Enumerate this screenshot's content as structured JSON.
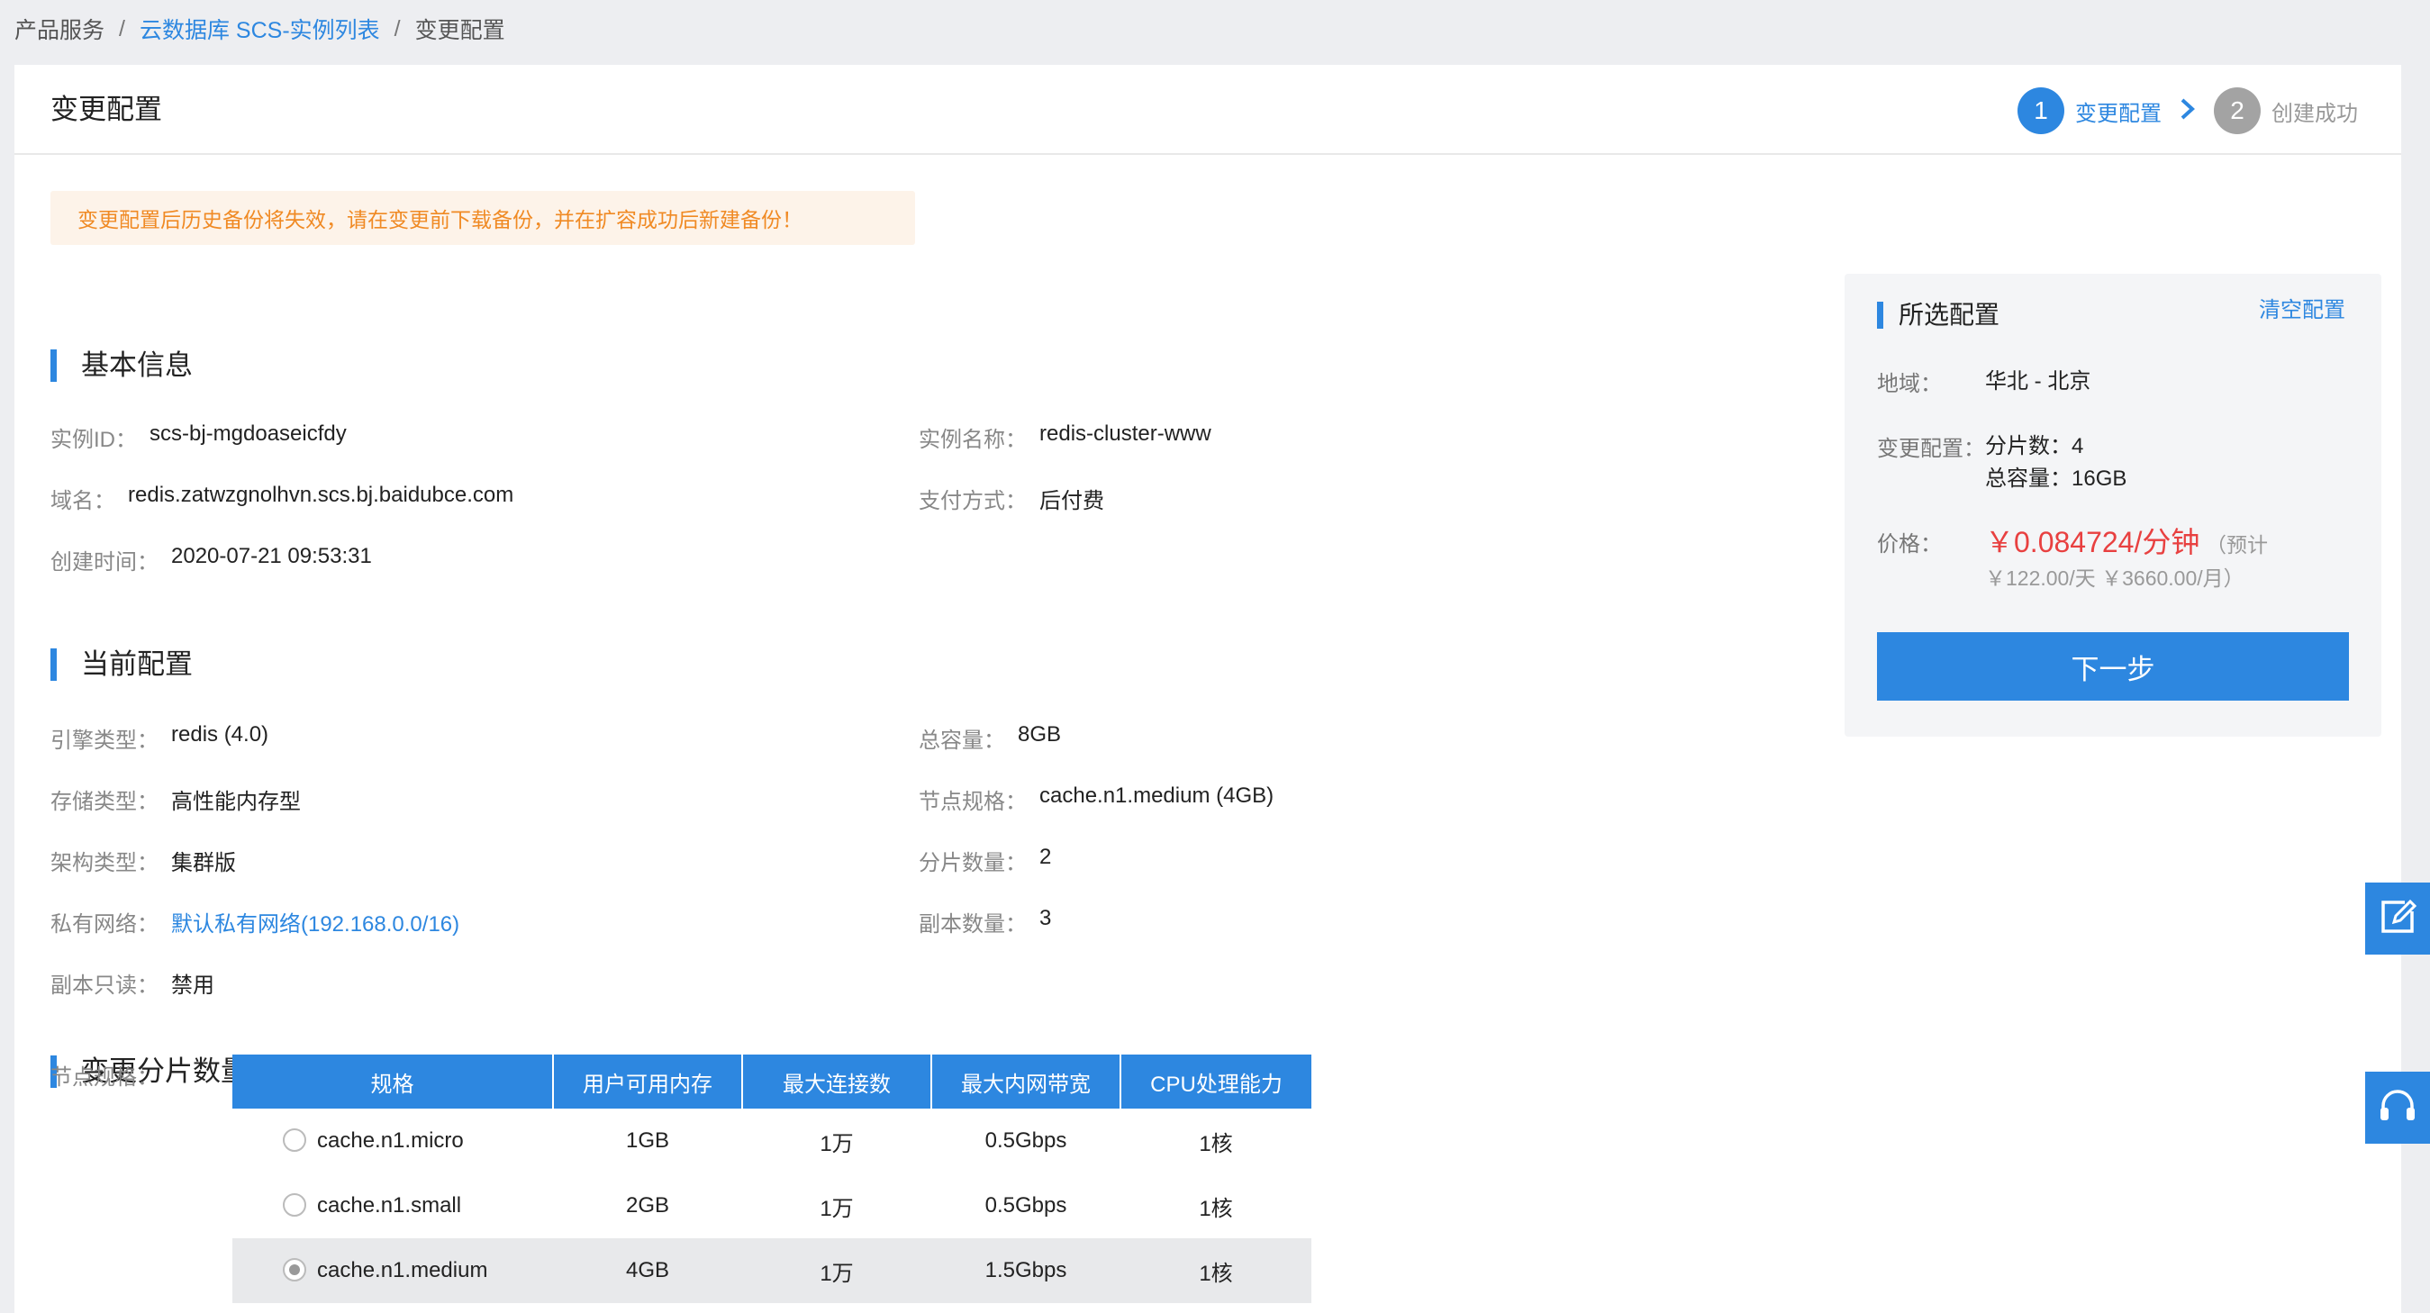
{
  "breadcrumb": {
    "item1": "产品服务",
    "item2": "云数据库 SCS-实例列表",
    "item3": "变更配置",
    "sep": "/"
  },
  "page_title": "变更配置",
  "steps": [
    {
      "num": "1",
      "label": "变更配置"
    },
    {
      "num": "2",
      "label": "创建成功"
    }
  ],
  "warning": "变更配置后历史备份将失效，请在变更前下载备份，并在扩容成功后新建备份！",
  "basic": {
    "title": "基本信息",
    "instance_id_label": "实例ID：",
    "instance_id": "scs-bj-mgdoaseicfdy",
    "instance_name_label": "实例名称：",
    "instance_name": "redis-cluster-www",
    "domain_label": "域名：",
    "domain": "redis.zatwzgnolhvn.scs.bj.baidubce.com",
    "pay_label": "支付方式：",
    "pay": "后付费",
    "created_label": "创建时间：",
    "created": "2020-07-21 09:53:31"
  },
  "current": {
    "title": "当前配置",
    "engine_label": "引擎类型：",
    "engine": "redis (4.0)",
    "capacity_label": "总容量：",
    "capacity": "8GB",
    "storage_label": "存储类型：",
    "storage": "高性能内存型",
    "node_spec_label": "节点规格：",
    "node_spec": "cache.n1.medium (4GB)",
    "arch_label": "架构类型：",
    "arch": "集群版",
    "shards_label": "分片数量：",
    "shards": "2",
    "vpc_label": "私有网络：",
    "vpc": "默认私有网络(192.168.0.0/16)",
    "replicas_label": "副本数量：",
    "replicas": "3",
    "readonly_label": "副本只读：",
    "readonly": "禁用"
  },
  "shard_change": {
    "title": "变更分片数量",
    "spec_label": "节点规格：",
    "columns": [
      "规格",
      "用户可用内存",
      "最大连接数",
      "最大内网带宽",
      "CPU处理能力"
    ],
    "rows": [
      {
        "name": "cache.n1.micro",
        "memory": "1GB",
        "conn": "1万",
        "bw": "0.5Gbps",
        "cpu": "1核",
        "selected": false
      },
      {
        "name": "cache.n1.small",
        "memory": "2GB",
        "conn": "1万",
        "bw": "0.5Gbps",
        "cpu": "1核",
        "selected": false
      },
      {
        "name": "cache.n1.medium",
        "memory": "4GB",
        "conn": "1万",
        "bw": "1.5Gbps",
        "cpu": "1核",
        "selected": true
      }
    ]
  },
  "summary": {
    "title": "所选配置",
    "clear": "清空配置",
    "region_label": "地域：",
    "region": "华北 - 北京",
    "change_label": "变更配置：",
    "change_shards": "分片数：4",
    "change_capacity": "总容量：16GB",
    "price_label": "价格：",
    "price": "￥0.084724/分钟",
    "price_est1": "（预计",
    "price_est2": "￥122.00/天 ￥3660.00/月）",
    "next": "下一步"
  },
  "icons": {
    "edit": "edit-icon",
    "support": "headset-icon"
  },
  "colors": {
    "accent": "#2d87e0",
    "warning_text": "#f08a24",
    "price": "#e84040"
  }
}
